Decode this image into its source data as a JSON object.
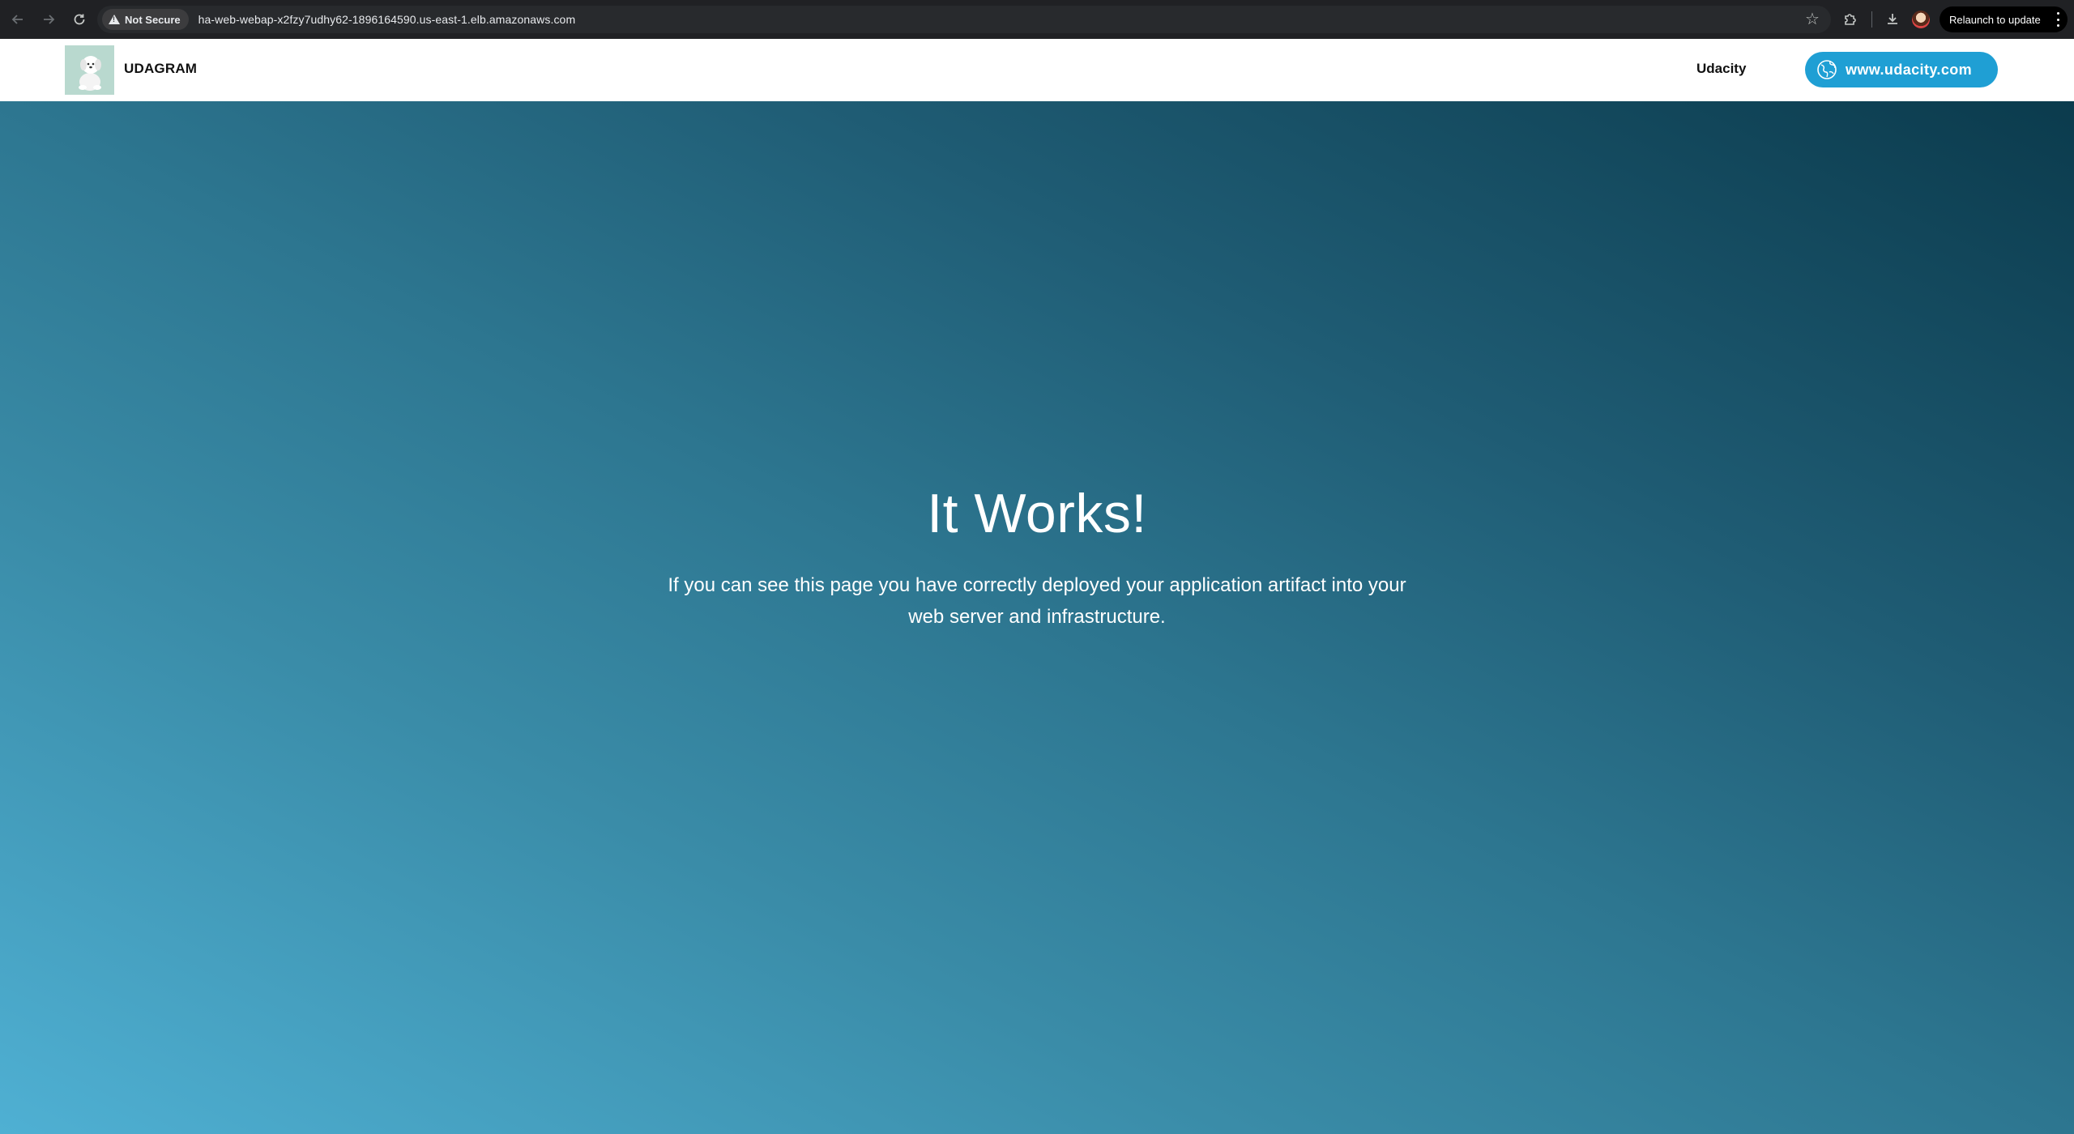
{
  "browser": {
    "security_label": "Not Secure",
    "url": "ha-web-webap-x2fzy7udhy62-1896164590.us-east-1.elb.amazonaws.com",
    "relaunch_label": "Relaunch to update",
    "icons": {
      "back": "arrow-left-icon",
      "forward": "arrow-right-icon",
      "reload": "reload-icon",
      "bookmark": "star-icon",
      "extensions": "puzzle-icon",
      "downloads": "download-icon",
      "profile": "avatar",
      "menu": "kebab-icon"
    }
  },
  "header": {
    "brand": "UDAGRAM",
    "nav_link": "Udacity",
    "cta_label": "www.udacity.com",
    "cta_icon": "globe-icon",
    "colors": {
      "cta_bg": "#1f9fd4",
      "logo_bg": "#b9d9cf"
    }
  },
  "hero": {
    "title": "It Works!",
    "text": "If you can see this page you have correctly deployed your application artifact into your web server and infrastructure.",
    "colors": {
      "gradient_light": "#4fb0d3",
      "gradient_dark": "#0b3b4d"
    }
  }
}
